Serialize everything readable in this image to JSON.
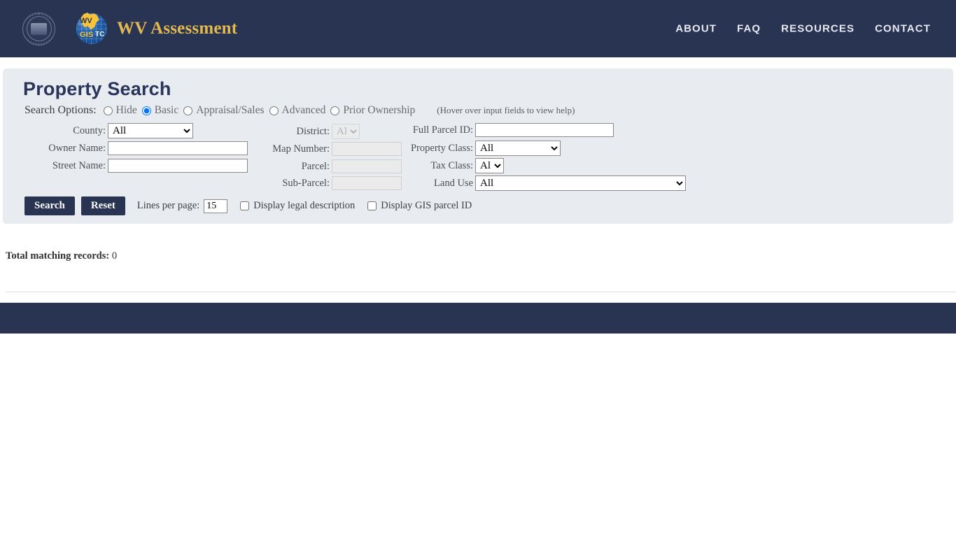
{
  "header": {
    "brand_title": "WV Assessment",
    "seal_name": "west-virginia-state-seal",
    "logo": {
      "wv_text": "WV",
      "gis_text": "GIS",
      "tc_text": "TC"
    },
    "nav": [
      {
        "label": "ABOUT"
      },
      {
        "label": "FAQ"
      },
      {
        "label": "RESOURCES"
      },
      {
        "label": "CONTACT"
      }
    ]
  },
  "search": {
    "page_title": "Property Search",
    "options_label": "Search Options:",
    "options": [
      {
        "label": "Hide",
        "selected": false
      },
      {
        "label": "Basic",
        "selected": true
      },
      {
        "label": "Appraisal/Sales",
        "selected": false
      },
      {
        "label": "Advanced",
        "selected": false
      },
      {
        "label": "Prior Ownership",
        "selected": false
      }
    ],
    "hover_hint": "(Hover over input fields to view help)",
    "fields": {
      "county": {
        "label": "County:",
        "value": "All",
        "type": "select"
      },
      "owner_name": {
        "label": "Owner Name:",
        "value": "",
        "type": "text"
      },
      "street_name": {
        "label": "Street Name:",
        "value": "",
        "type": "text"
      },
      "district": {
        "label": "District:",
        "value": "All",
        "type": "select",
        "disabled": true
      },
      "map_number": {
        "label": "Map Number:",
        "value": "",
        "type": "text",
        "disabled": true
      },
      "parcel": {
        "label": "Parcel:",
        "value": "",
        "type": "text",
        "disabled": true
      },
      "sub_parcel": {
        "label": "Sub-Parcel:",
        "value": "",
        "type": "text",
        "disabled": true
      },
      "full_parcel_id": {
        "label": "Full Parcel ID:",
        "value": "",
        "type": "text"
      },
      "property_class": {
        "label": "Property Class:",
        "value": "All",
        "type": "select"
      },
      "tax_class": {
        "label": "Tax Class:",
        "value": "All",
        "type": "select"
      },
      "land_use": {
        "label": "Land Use",
        "value": "All",
        "type": "select"
      }
    },
    "actions": {
      "search_label": "Search",
      "reset_label": "Reset",
      "lines_per_page_label": "Lines per page:",
      "lines_per_page_value": "15",
      "legal_description_label": "Display legal description",
      "legal_description_checked": false,
      "gis_parcel_id_label": "Display GIS parcel ID",
      "gis_parcel_id_checked": false
    }
  },
  "results": {
    "total_label": "Total matching records:",
    "total_value": "0"
  },
  "colors": {
    "navy": "#293453",
    "gold": "#e2b851",
    "panel": "#e8ecf1",
    "accent_blue": "#1a73e8"
  }
}
